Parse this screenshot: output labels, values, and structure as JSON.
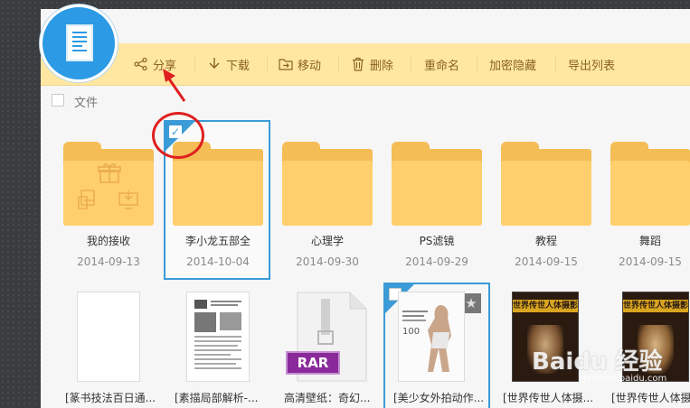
{
  "toolbar": {
    "share": "分享",
    "download": "下载",
    "move": "移动",
    "delete": "删除",
    "rename": "重命名",
    "encrypt_hide": "加密隐藏",
    "export_list": "导出列表"
  },
  "header": {
    "file_label": "文件"
  },
  "folders": [
    {
      "name": "我的接收",
      "date": "2014-09-13"
    },
    {
      "name": "李小龙五部全",
      "date": "2014-10-04"
    },
    {
      "name": "心理学",
      "date": "2014-09-30"
    },
    {
      "name": "PS滤镜",
      "date": "2014-09-29"
    },
    {
      "name": "教程",
      "date": "2014-09-15"
    },
    {
      "name": "舞蹈",
      "date": "2014-09-15"
    }
  ],
  "files": [
    {
      "label": "[篆书技法百日通..."
    },
    {
      "label": "[素描局部解析-..."
    },
    {
      "label": "高清壁纸：奇幻..."
    },
    {
      "label": "[美少女外拍动作..."
    },
    {
      "label": "[世界传世人体摄..."
    },
    {
      "label": "[世界传世人体摄..."
    }
  ],
  "thumb_texts": {
    "rar_badge": "RAR",
    "book_title": "世界传世人体摄影",
    "magazine_number": "100"
  },
  "watermark": {
    "brand": "Baidu 经验",
    "sub": "jingyan.baidu.com"
  },
  "colors": {
    "toolbar_bg": "#ffe7a2",
    "toolbar_text": "#8a6220",
    "folder": "#ffcf6d",
    "selection": "#3b9bd7",
    "annotation": "#e02020",
    "logo": "#2c9ae4"
  }
}
